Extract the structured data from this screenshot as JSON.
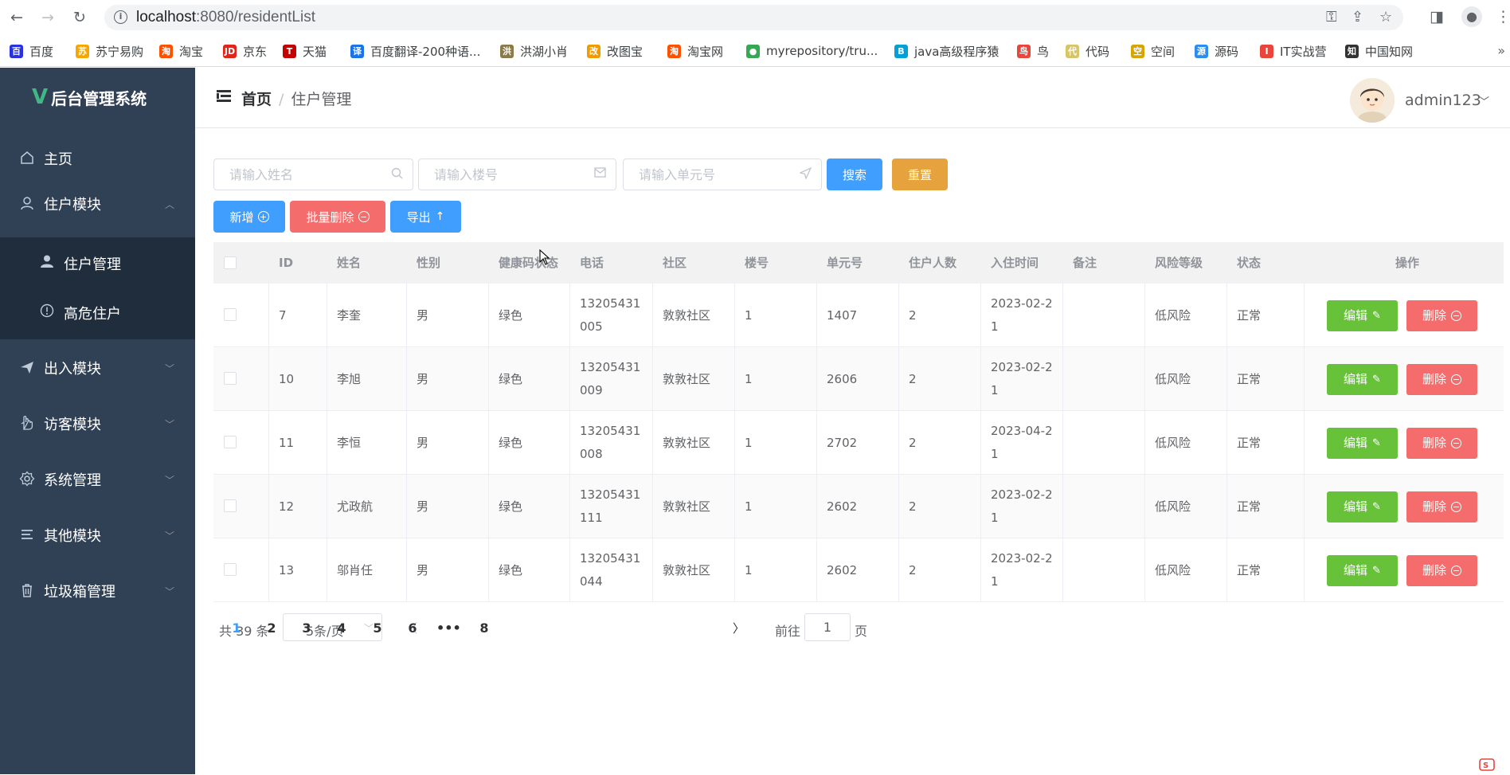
{
  "browser": {
    "url_host": "localhost",
    "url_path": ":8080/residentList",
    "bookmarks": [
      {
        "label": "百度",
        "icon": "baidu-icon",
        "color": "#2932e1",
        "glyph": "百"
      },
      {
        "label": "苏宁易购",
        "icon": "suning-icon",
        "color": "#f7a600",
        "glyph": "苏"
      },
      {
        "label": "淘宝",
        "icon": "taobao-icon",
        "color": "#ff5000",
        "glyph": "淘"
      },
      {
        "label": "京东",
        "icon": "jd-icon",
        "color": "#e1251b",
        "glyph": "JD"
      },
      {
        "label": "天猫",
        "icon": "tmall-icon",
        "color": "#c40000",
        "glyph": "T"
      },
      {
        "label": "百度翻译-200种语...",
        "icon": "baidu-translate-icon",
        "color": "#1a73e8",
        "glyph": "译"
      },
      {
        "label": "洪湖小肖",
        "icon": "bird-icon",
        "color": "#8a7a4a",
        "glyph": "洪"
      },
      {
        "label": "改图宝",
        "icon": "gaitubao-icon",
        "color": "#f29b00",
        "glyph": "改"
      },
      {
        "label": "淘宝网",
        "icon": "taobao-net-icon",
        "color": "#ff5000",
        "glyph": "淘"
      },
      {
        "label": "myrepository/tru...",
        "icon": "chrome-icon",
        "color": "#34a853",
        "glyph": "●"
      },
      {
        "label": "java高级程序猿",
        "icon": "bilibili-icon",
        "color": "#00a1d6",
        "glyph": "B"
      },
      {
        "label": "鸟",
        "icon": "bird-red-icon",
        "color": "#e8453c",
        "glyph": "鸟"
      },
      {
        "label": "代码",
        "icon": "code-icon",
        "color": "#d6c56a",
        "glyph": "代"
      },
      {
        "label": "空间",
        "icon": "qzone-icon",
        "color": "#d8a400",
        "glyph": "空"
      },
      {
        "label": "源码",
        "icon": "fish-icon",
        "color": "#2d8cf0",
        "glyph": "源"
      },
      {
        "label": "IT实战营",
        "icon": "it-icon",
        "color": "#e8453c",
        "glyph": "I"
      },
      {
        "label": "中国知网",
        "icon": "cnki-icon",
        "color": "#333333",
        "glyph": "知"
      }
    ]
  },
  "sidebar": {
    "logo_text": "后台管理系统",
    "logo_mark": "V",
    "items": [
      {
        "label": "主页",
        "icon": "home-icon"
      },
      {
        "label": "住户模块",
        "icon": "user-icon"
      },
      {
        "label": "住户管理",
        "icon": "user-filled-icon"
      },
      {
        "label": "高危住户",
        "icon": "warning-icon"
      },
      {
        "label": "出入模块",
        "icon": "send-icon"
      },
      {
        "label": "访客模块",
        "icon": "hand-icon"
      },
      {
        "label": "系统管理",
        "icon": "settings-icon"
      },
      {
        "label": "其他模块",
        "icon": "menu-icon"
      },
      {
        "label": "垃圾箱管理",
        "icon": "trash-icon"
      }
    ]
  },
  "header": {
    "breadcrumb_home": "首页",
    "breadcrumb_sep": "/",
    "breadcrumb_current": "住户管理",
    "username": "admin123"
  },
  "search": {
    "name_placeholder": "请输入姓名",
    "building_placeholder": "请输入楼号",
    "unit_placeholder": "请输入单元号",
    "search_label": "搜索",
    "reset_label": "重置"
  },
  "actions": {
    "add_label": "新增",
    "batch_delete_label": "批量删除",
    "export_label": "导出"
  },
  "table": {
    "columns": [
      "ID",
      "姓名",
      "性别",
      "健康码状态",
      "电话",
      "社区",
      "楼号",
      "单元号",
      "住户人数",
      "入住时间",
      "备注",
      "风险等级",
      "状态",
      "操作"
    ],
    "edit_label": "编辑",
    "delete_label": "删除",
    "rows": [
      {
        "id": "7",
        "name": "李奎",
        "gender": "男",
        "health": "绿色",
        "phone": "13205431005",
        "community": "敦敦社区",
        "building": "1",
        "unit": "1407",
        "count": "2",
        "date": "2023-02-21",
        "note": "",
        "risk": "低风险",
        "status": "正常"
      },
      {
        "id": "10",
        "name": "李旭",
        "gender": "男",
        "health": "绿色",
        "phone": "13205431009",
        "community": "敦敦社区",
        "building": "1",
        "unit": "2606",
        "count": "2",
        "date": "2023-02-21",
        "note": "",
        "risk": "低风险",
        "status": "正常"
      },
      {
        "id": "11",
        "name": "李恒",
        "gender": "男",
        "health": "绿色",
        "phone": "13205431008",
        "community": "敦敦社区",
        "building": "1",
        "unit": "2702",
        "count": "2",
        "date": "2023-04-21",
        "note": "",
        "risk": "低风险",
        "status": "正常"
      },
      {
        "id": "12",
        "name": "尤政航",
        "gender": "男",
        "health": "绿色",
        "phone": "13205431111",
        "community": "敦敦社区",
        "building": "1",
        "unit": "2602",
        "count": "2",
        "date": "2023-02-21",
        "note": "",
        "risk": "低风险",
        "status": "正常"
      },
      {
        "id": "13",
        "name": "邬肖任",
        "gender": "男",
        "health": "绿色",
        "phone": "13205431044",
        "community": "敦敦社区",
        "building": "1",
        "unit": "2602",
        "count": "2",
        "date": "2023-02-21",
        "note": "",
        "risk": "低风险",
        "status": "正常"
      }
    ]
  },
  "pagination": {
    "total_text": "共 39 条",
    "page_size": "5条/页",
    "pages": [
      "1",
      "2",
      "3",
      "4",
      "5",
      "6",
      "•••",
      "8"
    ],
    "current_page": "1",
    "goto_label": "前往",
    "goto_value": "1",
    "goto_unit": "页"
  },
  "colors": {
    "sidebar_bg": "#304156",
    "sidebar_active_bg": "#1f2d3d",
    "primary": "#409eff",
    "warning": "#e6a23c",
    "danger": "#f56c6c",
    "success": "#67c23a"
  }
}
